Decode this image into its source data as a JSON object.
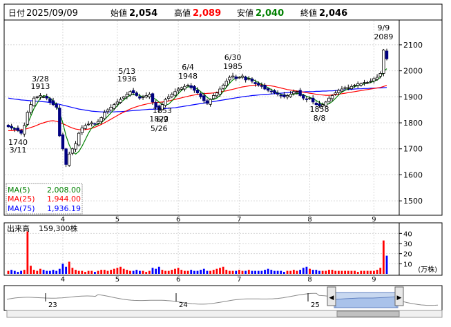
{
  "header": {
    "date_label": "日付",
    "date": "2025/09/09",
    "open_label": "始値",
    "open": "2,054",
    "high_label": "高値",
    "high": "2,089",
    "low_label": "安値",
    "low": "2,040",
    "close_label": "終値",
    "close": "2,046"
  },
  "colors": {
    "up": "#008000",
    "down": "#000080",
    "high": "#ff0000",
    "low": "#008000",
    "ma5": "#008000",
    "ma25": "#ff0000",
    "ma75": "#0000ff",
    "vol_up": "#ff0000",
    "vol_down": "#0000ff",
    "overview_fill": "#c8d8f0"
  },
  "legend": {
    "ma5": "MA(5)",
    "ma5_value": "2,008.00",
    "ma25": "MA(25)",
    "ma25_value": "1,944.00",
    "ma75": "MA(75)",
    "ma75_value": "1,936.19"
  },
  "volume": {
    "label": "出来高",
    "value": "159,300株",
    "unit": "(万株)"
  },
  "overview": {
    "year_labels": [
      "23",
      "24",
      "25"
    ],
    "scroll_left": "◀",
    "scroll_right": "▶"
  },
  "chart_data": {
    "type": "candlestick",
    "price_ylim": [
      1450,
      2190
    ],
    "price_ticks": [
      1500,
      1600,
      1700,
      1800,
      1900,
      2000,
      2100
    ],
    "volume_ylim": [
      0,
      45
    ],
    "volume_ticks": [
      10,
      20,
      30,
      40
    ],
    "month_labels": [
      "4",
      "5",
      "6",
      "7",
      "8",
      "9"
    ],
    "annotations": [
      {
        "value": "1740",
        "date": "3/11"
      },
      {
        "value": "1913",
        "date": "3/28"
      },
      {
        "value": "1936",
        "date": "5/13"
      },
      {
        "value": "1822",
        "date": "5/26"
      },
      {
        "value": "1948",
        "date": "6/4"
      },
      {
        "value": "1853",
        "date": "6/9"
      },
      {
        "value": "1985",
        "date": "6/30"
      },
      {
        "value": "1858",
        "date": "8/8"
      },
      {
        "value": "2089",
        "date": "9/9"
      }
    ],
    "close_path": [
      1785,
      1780,
      1775,
      1770,
      1760,
      1790,
      1840,
      1870,
      1895,
      1900,
      1905,
      1900,
      1895,
      1880,
      1870,
      1860,
      1750,
      1700,
      1640,
      1680,
      1700,
      1720,
      1760,
      1780,
      1790,
      1795,
      1800,
      1795,
      1805,
      1820,
      1840,
      1850,
      1860,
      1870,
      1880,
      1890,
      1900,
      1910,
      1920,
      1915,
      1905,
      1895,
      1900,
      1905,
      1910,
      1880,
      1860,
      1850,
      1870,
      1890,
      1900,
      1910,
      1920,
      1930,
      1935,
      1940,
      1945,
      1935,
      1925,
      1915,
      1900,
      1885,
      1875,
      1890,
      1905,
      1915,
      1930,
      1945,
      1960,
      1975,
      1980,
      1970,
      1975,
      1980,
      1965,
      1970,
      1960,
      1950,
      1945,
      1940,
      1930,
      1925,
      1920,
      1915,
      1910,
      1905,
      1900,
      1905,
      1910,
      1920,
      1920,
      1905,
      1895,
      1890,
      1895,
      1880,
      1870,
      1865,
      1870,
      1880,
      1895,
      1905,
      1915,
      1925,
      1930,
      1935,
      1935,
      1940,
      1945,
      1950,
      1950,
      1955,
      1955,
      1960,
      1970,
      1975,
      1990,
      2080,
      2046
    ],
    "ma5_path": [
      1790,
      1785,
      1780,
      1772,
      1765,
      1770,
      1795,
      1825,
      1855,
      1875,
      1895,
      1905,
      1902,
      1895,
      1885,
      1870,
      1840,
      1800,
      1750,
      1715,
      1690,
      1680,
      1690,
      1710,
      1735,
      1760,
      1780,
      1790,
      1795,
      1800,
      1812,
      1825,
      1838,
      1852,
      1866,
      1878,
      1888,
      1898,
      1906,
      1910,
      1910,
      1905,
      1900,
      1900,
      1903,
      1898,
      1890,
      1880,
      1870,
      1868,
      1872,
      1884,
      1898,
      1912,
      1925,
      1933,
      1938,
      1939,
      1936,
      1930,
      1920,
      1910,
      1898,
      1890,
      1890,
      1895,
      1905,
      1920,
      1937,
      1952,
      1965,
      1972,
      1975,
      1976,
      1974,
      1972,
      1968,
      1962,
      1955,
      1948,
      1942,
      1935,
      1928,
      1922,
      1915,
      1910,
      1906,
      1904,
      1905,
      1910,
      1913,
      1912,
      1908,
      1902,
      1898,
      1893,
      1886,
      1878,
      1872,
      1870,
      1873,
      1882,
      1894,
      1907,
      1918,
      1925,
      1930,
      1935,
      1939,
      1943,
      1946,
      1950,
      1952,
      1955,
      1960,
      1965,
      1975,
      1997,
      2008
    ],
    "ma25_path": [
      1770,
      1770,
      1771,
      1772,
      1773,
      1775,
      1778,
      1782,
      1786,
      1791,
      1796,
      1800,
      1804,
      1807,
      1808,
      1806,
      1802,
      1797,
      1791,
      1785,
      1780,
      1776,
      1774,
      1773,
      1774,
      1776,
      1779,
      1783,
      1788,
      1794,
      1800,
      1807,
      1814,
      1821,
      1828,
      1835,
      1841,
      1847,
      1853,
      1858,
      1862,
      1866,
      1869,
      1872,
      1875,
      1877,
      1878,
      1879,
      1880,
      1882,
      1884,
      1887,
      1890,
      1893,
      1896,
      1899,
      1902,
      1905,
      1907,
      1909,
      1911,
      1912,
      1913,
      1914,
      1915,
      1917,
      1919,
      1921,
      1923,
      1926,
      1929,
      1932,
      1935,
      1938,
      1940,
      1942,
      1944,
      1945,
      1946,
      1946,
      1945,
      1944,
      1942,
      1940,
      1937,
      1934,
      1931,
      1928,
      1926,
      1924,
      1922,
      1920,
      1918,
      1916,
      1914,
      1912,
      1910,
      1908,
      1907,
      1906,
      1906,
      1907,
      1908,
      1910,
      1912,
      1914,
      1916,
      1918,
      1920,
      1922,
      1924,
      1926,
      1928,
      1930,
      1932,
      1934,
      1936,
      1940,
      1944
    ],
    "ma75_path": [
      1895,
      1893,
      1891,
      1890,
      1888,
      1887,
      1886,
      1885,
      1884,
      1883,
      1882,
      1881,
      1880,
      1878,
      1876,
      1874,
      1871,
      1868,
      1865,
      1862,
      1859,
      1856,
      1853,
      1851,
      1849,
      1847,
      1845,
      1844,
      1843,
      1842,
      1842,
      1842,
      1842,
      1842,
      1843,
      1843,
      1844,
      1845,
      1846,
      1847,
      1848,
      1849,
      1850,
      1851,
      1852,
      1852,
      1853,
      1853,
      1854,
      1855,
      1856,
      1857,
      1858,
      1860,
      1862,
      1864,
      1866,
      1868,
      1870,
      1872,
      1874,
      1876,
      1878,
      1880,
      1882,
      1884,
      1886,
      1888,
      1890,
      1892,
      1894,
      1896,
      1898,
      1900,
      1902,
      1903,
      1905,
      1906,
      1907,
      1908,
      1909,
      1910,
      1911,
      1912,
      1913,
      1914,
      1915,
      1916,
      1917,
      1918,
      1918,
      1919,
      1919,
      1920,
      1920,
      1920,
      1921,
      1921,
      1922,
      1922,
      1923,
      1923,
      1924,
      1925,
      1926,
      1927,
      1928,
      1929,
      1930,
      1931,
      1931,
      1932,
      1932,
      1933,
      1933,
      1934,
      1934,
      1935,
      1936
    ],
    "volume_path": [
      3,
      4,
      3,
      2,
      3,
      4,
      42,
      8,
      4,
      3,
      5,
      4,
      3,
      3,
      4,
      3,
      5,
      10,
      7,
      12,
      6,
      4,
      3,
      3,
      2,
      3,
      3,
      2,
      3,
      4,
      4,
      3,
      4,
      5,
      6,
      7,
      5,
      4,
      3,
      3,
      4,
      3,
      3,
      2,
      3,
      6,
      5,
      7,
      4,
      3,
      3,
      4,
      5,
      6,
      4,
      3,
      3,
      4,
      3,
      3,
      4,
      5,
      3,
      3,
      4,
      5,
      6,
      7,
      4,
      3,
      3,
      3,
      4,
      3,
      3,
      4,
      3,
      3,
      3,
      3,
      4,
      5,
      4,
      3,
      3,
      3,
      2,
      3,
      3,
      4,
      3,
      4,
      6,
      7,
      5,
      4,
      4,
      3,
      3,
      3,
      4,
      4,
      3,
      3,
      3,
      3,
      3,
      3,
      3,
      2,
      3,
      3,
      3,
      3,
      3,
      4,
      6,
      33,
      18
    ]
  }
}
